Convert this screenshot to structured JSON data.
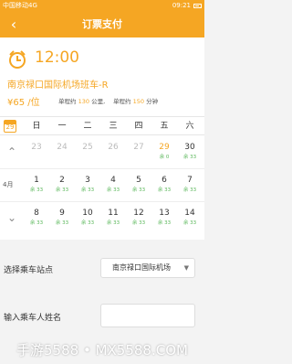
{
  "status": {
    "carrier": "中国移动4G",
    "time": "09:21"
  },
  "header": {
    "title": "订票支付",
    "back_icon": "‹"
  },
  "trip": {
    "time": "12:00",
    "route": "南京禄口国际机场班车-R",
    "price": "¥65 /位",
    "distance_prefix": "单程约",
    "distance_value": "130",
    "distance_unit": "公里,",
    "duration_prefix": "单程约",
    "duration_value": "150",
    "duration_unit": "分钟"
  },
  "calendar": {
    "icon_day": "29",
    "weekdays": [
      "日",
      "一",
      "二",
      "三",
      "四",
      "五",
      "六"
    ],
    "month_label": "4月",
    "week1": [
      {
        "d": "23",
        "t": ""
      },
      {
        "d": "24",
        "t": ""
      },
      {
        "d": "25",
        "t": ""
      },
      {
        "d": "26",
        "t": ""
      },
      {
        "d": "27",
        "t": ""
      },
      {
        "d": "29",
        "t": "余 0"
      },
      {
        "d": "30",
        "t": "余 33"
      }
    ],
    "week2": [
      {
        "d": "1",
        "t": "余 33"
      },
      {
        "d": "2",
        "t": "余 33"
      },
      {
        "d": "3",
        "t": "余 33"
      },
      {
        "d": "4",
        "t": "余 33"
      },
      {
        "d": "5",
        "t": "余 33"
      },
      {
        "d": "6",
        "t": "余 33"
      },
      {
        "d": "7",
        "t": "余 33"
      }
    ],
    "week3": [
      {
        "d": "8",
        "t": "余 33"
      },
      {
        "d": "9",
        "t": "余 33"
      },
      {
        "d": "10",
        "t": "余 33"
      },
      {
        "d": "11",
        "t": "余 33"
      },
      {
        "d": "12",
        "t": "余 33"
      },
      {
        "d": "13",
        "t": "余 33"
      },
      {
        "d": "14",
        "t": "余 33"
      }
    ]
  },
  "form": {
    "station_label": "选择乘车站点",
    "station_value": "南京禄口国际机场",
    "name_label": "输入乘车人姓名",
    "name_value": ""
  },
  "watermark": "手游5588 • MX5588.COM"
}
